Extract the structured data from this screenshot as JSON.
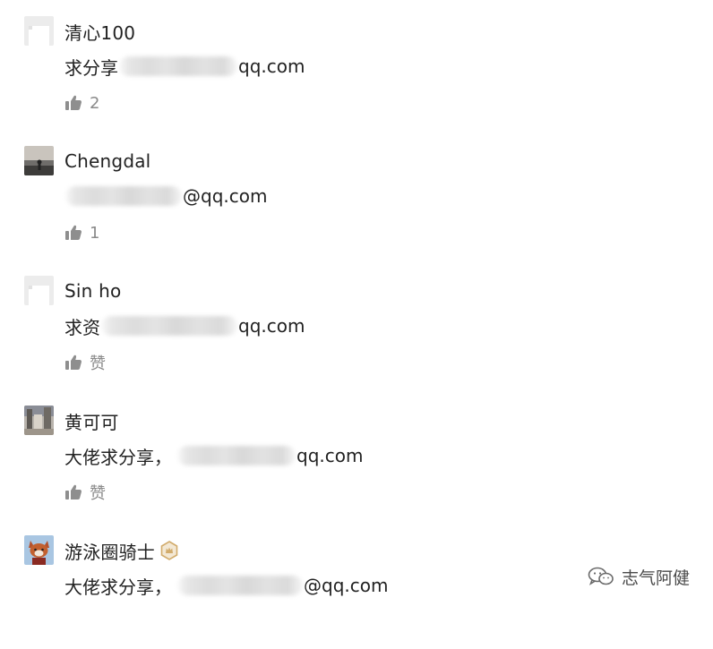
{
  "comments": [
    {
      "username": "清心100",
      "text_prefix": "求分享",
      "text_suffix": "qq.com",
      "likes": "2",
      "avatar": "blank-avatar-icon"
    },
    {
      "username": "Chengdal",
      "text_prefix": "",
      "text_suffix": "@qq.com",
      "likes": "1",
      "avatar": "photo-avatar-seaside"
    },
    {
      "username": "Sin ho",
      "text_prefix": "求资",
      "text_suffix": "qq.com",
      "likes": "赞",
      "avatar": "blank-avatar-icon"
    },
    {
      "username": "黄可可",
      "text_prefix": "大佬求分享，",
      "text_suffix": "qq.com",
      "likes": "赞",
      "avatar": "photo-avatar-street"
    },
    {
      "username": "游泳圈骑士",
      "text_prefix": "大佬求分享，",
      "text_suffix": "@qq.com",
      "likes": "",
      "avatar": "photo-avatar-fox",
      "badge": "crown-badge-icon"
    }
  ],
  "watermark": {
    "text": "志气阿健",
    "icon": "wechat-logo-icon"
  },
  "colors": {
    "text": "#222222",
    "muted": "#8a8a8a",
    "icon": "#8e8e8e",
    "badge": "#d2ac6c"
  }
}
